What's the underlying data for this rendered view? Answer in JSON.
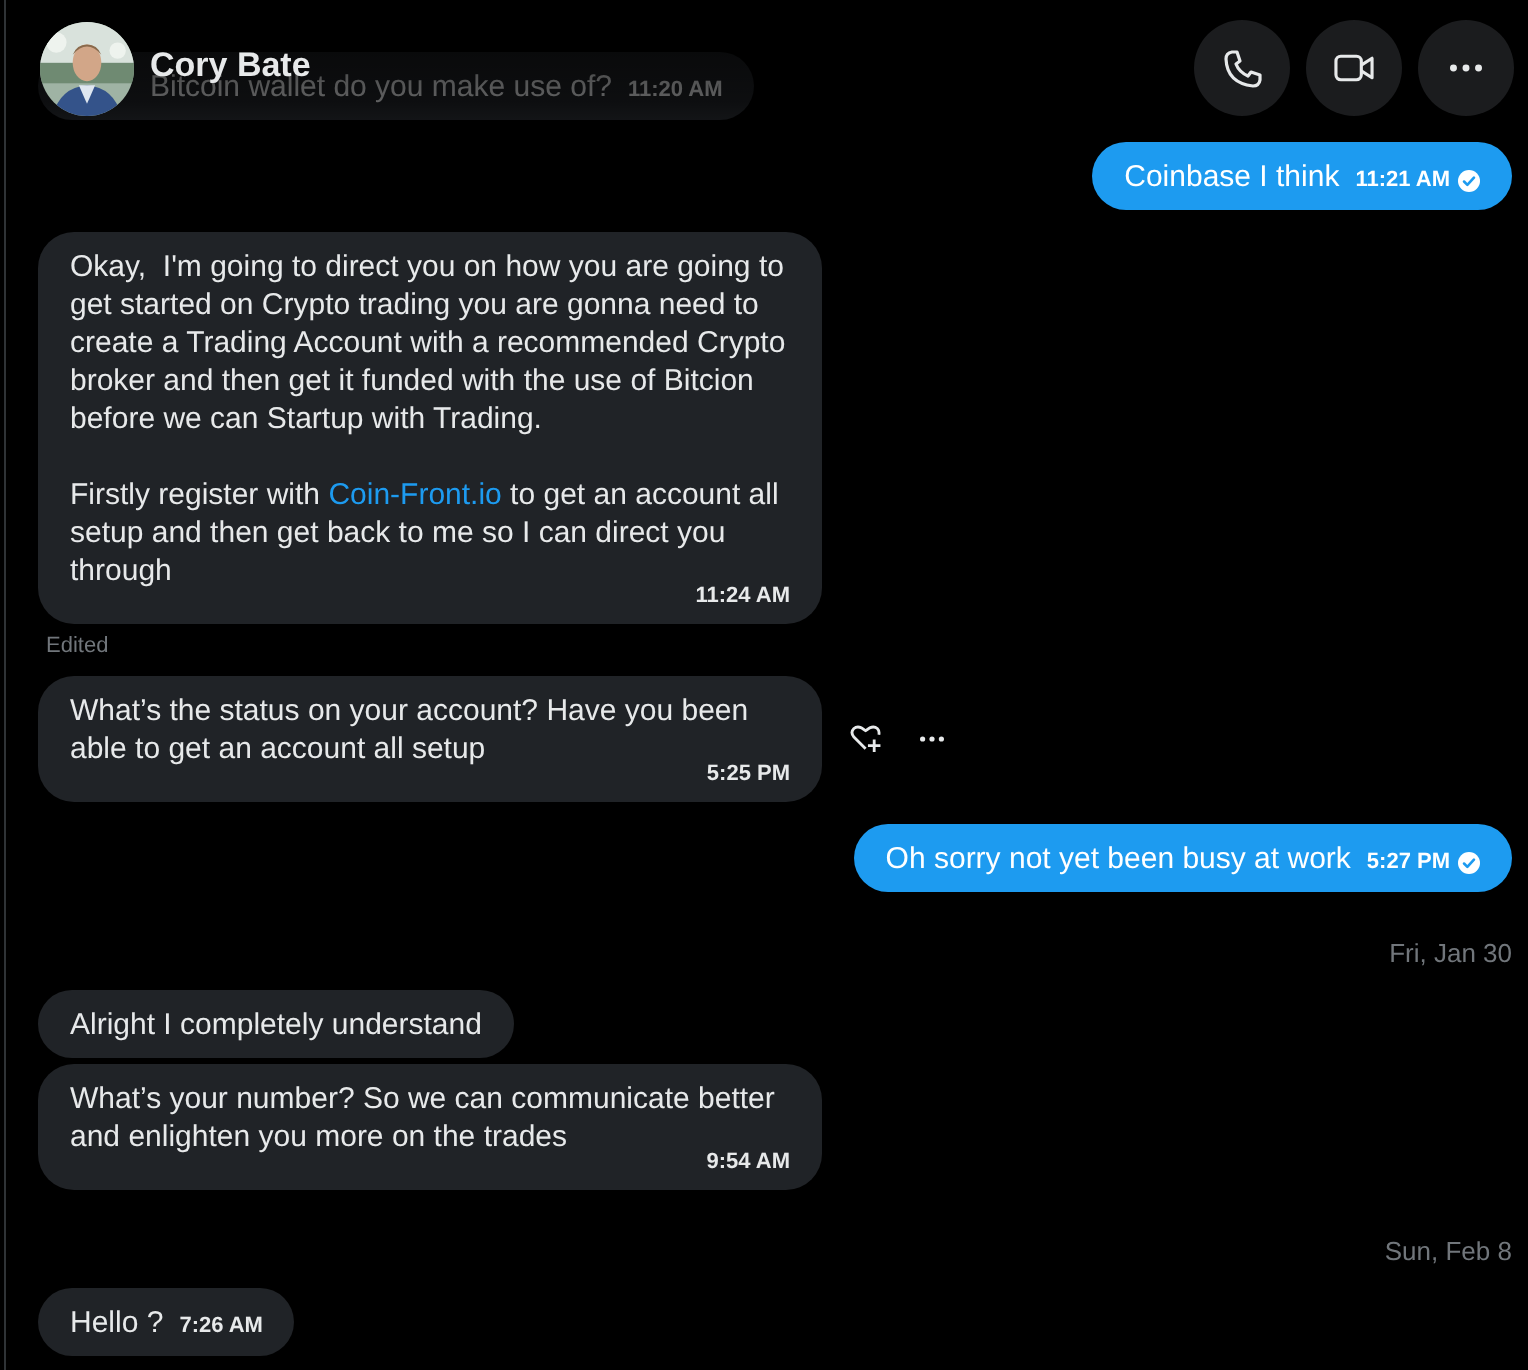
{
  "header": {
    "name": "Cory Bate",
    "actions": [
      {
        "kind": "call"
      },
      {
        "kind": "video"
      },
      {
        "kind": "more"
      }
    ]
  },
  "items": [
    {
      "kind": "incoming",
      "under_header": true,
      "paragraphs": [
        [
          {
            "kind": "text",
            "text": "Bitcoin wallet do you make use of?"
          }
        ]
      ],
      "time": "11:20 AM",
      "read": false,
      "edited": false,
      "hovered": false
    },
    {
      "kind": "outgoing",
      "under_header": false,
      "paragraphs": [
        [
          {
            "kind": "text",
            "text": "Coinbase I think"
          }
        ]
      ],
      "time": "11:21 AM",
      "read": true,
      "edited": false,
      "hovered": false
    },
    {
      "kind": "incoming",
      "under_header": false,
      "paragraphs": [
        [
          {
            "kind": "text",
            "text": "Okay,  I'm going to direct you on how you are going to get started on Crypto trading you are gonna need to create a Trading Account with a recommended Crypto broker and then get it funded with the use of Bitcion before we can Startup with Trading."
          }
        ],
        [
          {
            "kind": "text",
            "text": "Firstly register with "
          },
          {
            "kind": "link",
            "text": "Coin-Front.io"
          },
          {
            "kind": "text",
            "text": " to get an account all setup and then get back to me so I can direct you through"
          }
        ]
      ],
      "time": "11:24 AM",
      "read": false,
      "edited": true,
      "edited_label": "Edited",
      "hovered": false
    },
    {
      "kind": "incoming",
      "under_header": false,
      "paragraphs": [
        [
          {
            "kind": "text",
            "text": "What’s the status on your account? Have you been able to get an account all setup"
          }
        ]
      ],
      "time": "5:25 PM",
      "read": false,
      "edited": false,
      "hovered": true
    },
    {
      "kind": "outgoing",
      "under_header": false,
      "paragraphs": [
        [
          {
            "kind": "text",
            "text": "Oh sorry not yet been busy at work"
          }
        ]
      ],
      "time": "5:27 PM",
      "read": true,
      "edited": false,
      "hovered": false
    },
    {
      "kind": "date",
      "text": "Fri, Jan 30"
    },
    {
      "kind": "incoming",
      "under_header": false,
      "paragraphs": [
        [
          {
            "kind": "text",
            "text": "Alright I completely understand"
          }
        ]
      ],
      "read": false,
      "edited": false,
      "hovered": false
    },
    {
      "kind": "incoming",
      "under_header": false,
      "paragraphs": [
        [
          {
            "kind": "text",
            "text": "What’s your number? So we can communicate better and enlighten you more on the trades"
          }
        ]
      ],
      "time": "9:54 AM",
      "read": false,
      "edited": false,
      "hovered": false
    },
    {
      "kind": "date",
      "text": "Sun, Feb 8"
    },
    {
      "kind": "incoming",
      "under_header": false,
      "paragraphs": [
        [
          {
            "kind": "text",
            "text": "Hello ?"
          }
        ]
      ],
      "time": "7:26 AM",
      "read": false,
      "edited": false,
      "hovered": false
    }
  ]
}
